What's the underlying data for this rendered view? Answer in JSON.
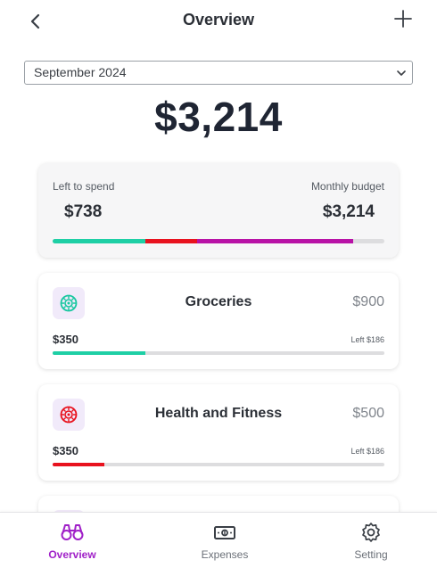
{
  "header": {
    "title": "Overview",
    "back_icon": "chevron-left-icon",
    "add_icon": "plus-icon"
  },
  "month_select": {
    "value": "September 2024"
  },
  "total": "$3,214",
  "summary": {
    "left_label": "Left to spend",
    "left_value": "$738",
    "budget_label": "Monthly budget",
    "budget_value": "$3,214",
    "segments": [
      {
        "color": "#1ecfa5",
        "fraction": 0.28
      },
      {
        "color": "#e8121e",
        "fraction": 0.155
      },
      {
        "color": "#b812a6",
        "fraction": 0.47
      }
    ]
  },
  "categories": [
    {
      "name": "Groceries",
      "budget": "$900",
      "spent": "$350",
      "left": "Left $186",
      "icon": "groceries-icon",
      "icon_color": "#18c7a0",
      "icon_bg": "#f1eafa",
      "bar_color": "#1ecfa5",
      "progress": 0.28
    },
    {
      "name": "Health and Fitness",
      "budget": "$500",
      "spent": "$350",
      "left": "Left $186",
      "icon": "fitness-icon",
      "icon_color": "#e8121e",
      "icon_bg": "#f1eafa",
      "bar_color": "#e8121e",
      "progress": 0.155
    }
  ],
  "nav": [
    {
      "label": "Overview",
      "icon": "binoculars-icon",
      "active": true
    },
    {
      "label": "Expenses",
      "icon": "banknote-icon",
      "active": false
    },
    {
      "label": "Setting",
      "icon": "gear-icon",
      "active": false
    }
  ],
  "colors": {
    "accent": "#a020c8"
  }
}
